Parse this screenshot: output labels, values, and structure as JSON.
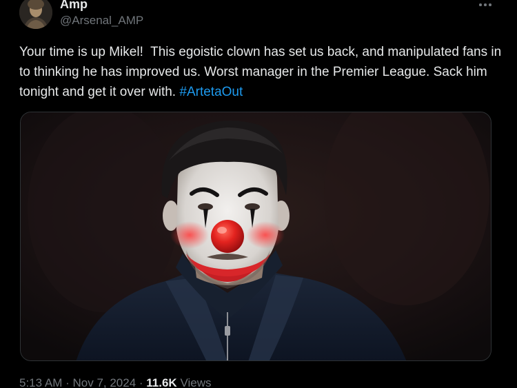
{
  "author": {
    "display_name": "Amp",
    "handle": "@Arsenal_AMP",
    "avatar_icon": "avatar-photo"
  },
  "more_icon": "more-horizontal-icon",
  "tweet": {
    "text": "Your time is up Mikel!  This egoistic clown has set us back, and manipulated fans in to thinking he has improved us. Worst manager in the Premier League. Sack him tonight and get it over with. ",
    "hashtag": "#ArtetaOut"
  },
  "media": {
    "kind": "photo"
  },
  "meta": {
    "time": "5:13 AM",
    "separator_1": " · ",
    "date": "Nov 7, 2024",
    "separator_2": " · ",
    "views_count": "11.6K",
    "views_label": " Views"
  },
  "colors": {
    "background": "#000000",
    "text_primary": "#e7e9ea",
    "text_secondary": "#71767b",
    "link": "#1d9bf0",
    "border": "#2f3336"
  }
}
